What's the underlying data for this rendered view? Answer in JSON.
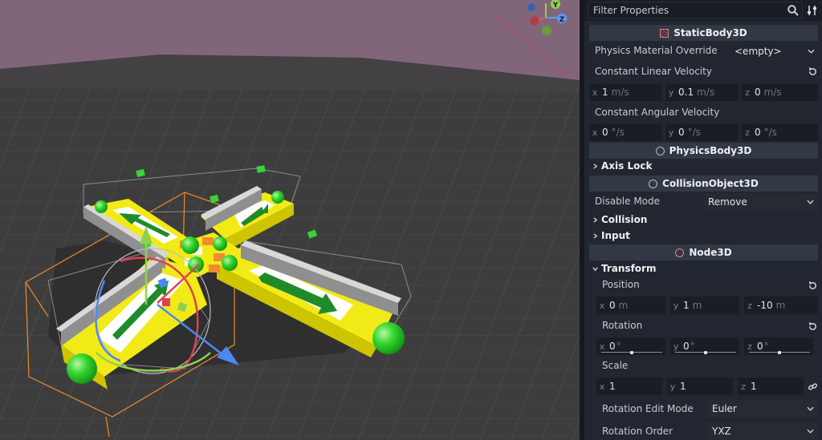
{
  "filter": {
    "placeholder": "Filter Properties",
    "search_icon": "search-icon",
    "options_icon": "tune-icon"
  },
  "sections": {
    "static_body": "StaticBody3D",
    "physics_body": "PhysicsBody3D",
    "collision_object": "CollisionObject3D",
    "node3d": "Node3D"
  },
  "physics_material": {
    "label": "Physics Material Override",
    "value": "<empty>"
  },
  "constant_linear_velocity": {
    "label": "Constant Linear Velocity",
    "x": "1",
    "y": "0.1",
    "z": "0",
    "unit": "m/s"
  },
  "constant_angular_velocity": {
    "label": "Constant Angular Velocity",
    "x": "0",
    "y": "0",
    "z": "0",
    "unit": "°/s"
  },
  "groups": {
    "axis_lock": "Axis Lock",
    "collision": "Collision",
    "input": "Input",
    "transform": "Transform"
  },
  "disable_mode": {
    "label": "Disable Mode",
    "value": "Remove"
  },
  "transform": {
    "position": {
      "label": "Position",
      "x": "0",
      "y": "1",
      "z": "-10",
      "unit": "m"
    },
    "rotation": {
      "label": "Rotation",
      "x": "0",
      "y": "0",
      "z": "0",
      "unit": "°"
    },
    "scale": {
      "label": "Scale",
      "x": "1",
      "y": "1",
      "z": "1"
    },
    "rotation_edit_mode": {
      "label": "Rotation Edit Mode",
      "value": "Euler"
    },
    "rotation_order": {
      "label": "Rotation Order",
      "value": "YXZ"
    }
  },
  "axis_labels": {
    "x": "x",
    "y": "y",
    "z": "z"
  },
  "gizmo_labels": {
    "y": "Y",
    "z": "Z"
  },
  "colors": {
    "axis_x": "#e0565b",
    "axis_y": "#8fd14f",
    "axis_z": "#5b9aff",
    "sky": "#816679",
    "ground": "#3d3d3d"
  }
}
